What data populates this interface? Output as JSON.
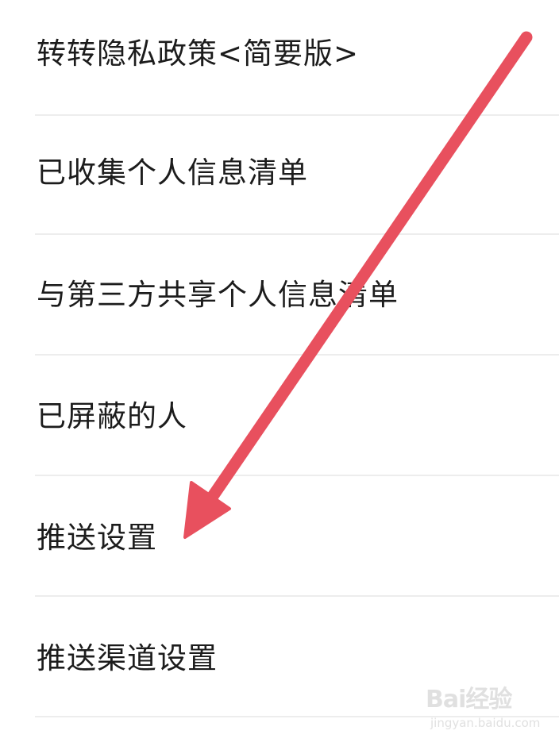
{
  "settings": {
    "items": [
      {
        "label": "转转隐私政策<简要版>"
      },
      {
        "label": "已收集个人信息清单"
      },
      {
        "label": "与第三方共享个人信息清单"
      },
      {
        "label": "已屏蔽的人"
      },
      {
        "label": "推送设置"
      },
      {
        "label": "推送渠道设置"
      }
    ]
  },
  "annotation": {
    "arrow_color": "#e8505e",
    "icon": "arrow-pointer-icon"
  },
  "watermark": {
    "logo_text": "Bai经验",
    "sub_text": "jingyan.baidu.com",
    "color": "#c8c8c8"
  }
}
